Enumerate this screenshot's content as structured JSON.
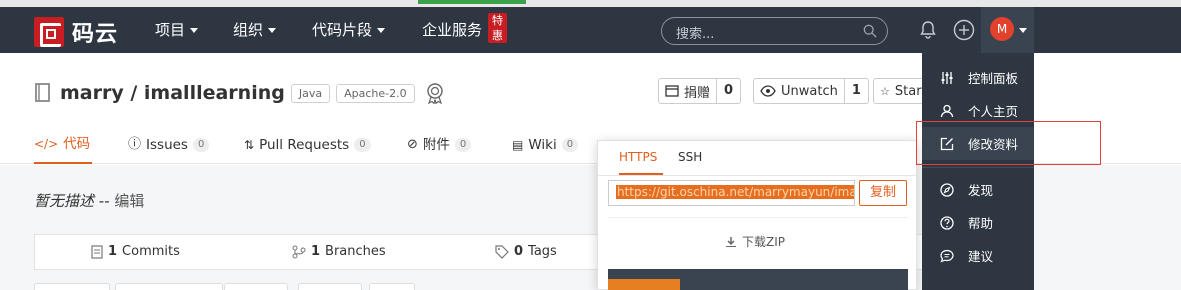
{
  "nav": {
    "logo_text": "码云",
    "items": [
      {
        "label": "项目"
      },
      {
        "label": "组织"
      },
      {
        "label": "代码片段"
      },
      {
        "label": "企业服务",
        "badge": "特惠"
      }
    ],
    "search_placeholder": "搜索...",
    "avatar_initial": "M"
  },
  "repo": {
    "owner": "marry",
    "sep": " / ",
    "name": "imalllearning",
    "tags": [
      "Java",
      "Apache-2.0"
    ],
    "donate": {
      "label": "捐赠",
      "count": "0"
    },
    "watch": {
      "label": "Unwatch",
      "count": "1"
    },
    "star": {
      "label": "Star"
    }
  },
  "tabs": [
    {
      "label": "代码",
      "count": null
    },
    {
      "label": "Issues",
      "count": "0"
    },
    {
      "label": "Pull Requests",
      "count": "0"
    },
    {
      "label": "附件",
      "count": "0"
    },
    {
      "label": "Wiki",
      "count": "0"
    }
  ],
  "description": {
    "text": "暂无描述",
    "sep": " -- ",
    "edit": "编辑"
  },
  "stats": {
    "commits": {
      "count": "1",
      "label": "Commits"
    },
    "branches": {
      "count": "1",
      "label": "Branches"
    },
    "tags": {
      "count": "0",
      "label": "Tags"
    }
  },
  "clone": {
    "tab_https": "HTTPS",
    "tab_ssh": "SSH",
    "url": "https://git.oschina.net/marrymayun/imalllearning.git",
    "copy_label": "复制",
    "zip_label": "下载ZIP"
  },
  "dropdown": {
    "items": [
      {
        "label": "控制面板",
        "icon": "sliders-icon"
      },
      {
        "label": "个人主页",
        "icon": "user-icon"
      },
      {
        "label": "修改资料",
        "icon": "edit-icon"
      },
      {
        "label": "发现",
        "icon": "compass-icon"
      },
      {
        "label": "帮助",
        "icon": "help-icon"
      },
      {
        "label": "建议",
        "icon": "chat-icon"
      }
    ]
  },
  "colors": {
    "nav_bg": "#2e3642",
    "accent": "#e25e1f",
    "brand_red": "#c71d23"
  }
}
